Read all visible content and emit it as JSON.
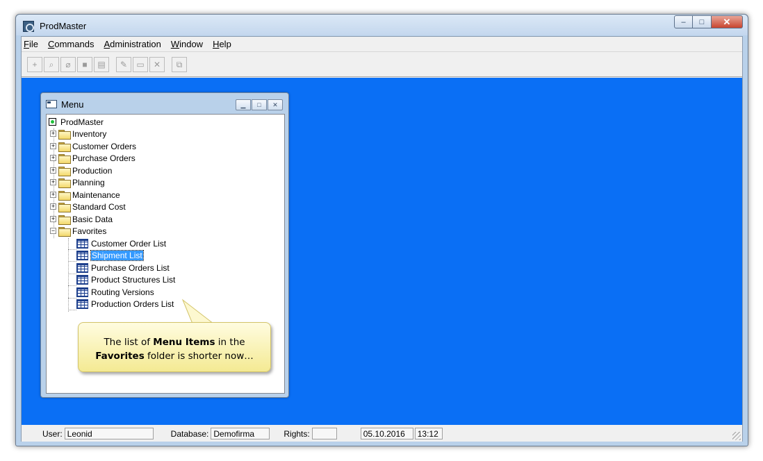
{
  "window": {
    "title": "ProdMaster",
    "buttons": {
      "minimize": "–",
      "maximize": "□",
      "close": "✕"
    }
  },
  "menubar": [
    "File",
    "Commands",
    "Administration",
    "Window",
    "Help"
  ],
  "toolbar": {
    "icons": [
      "add-icon",
      "binoculars-icon",
      "eraser-icon",
      "stop-icon",
      "document-icon",
      "new-folder-icon",
      "folder-icon",
      "delete-icon",
      "copy-icon"
    ]
  },
  "menu_window": {
    "title": "Menu",
    "root": "ProdMaster",
    "folders": [
      "Inventory",
      "Customer Orders",
      "Purchase Orders",
      "Production",
      "Planning",
      "Maintenance",
      "Standard Cost",
      "Basic Data",
      "Favorites"
    ],
    "favorites": [
      "Customer Order List",
      "Shipment List",
      "Purchase Orders List",
      "Product Structures List",
      "Routing Versions",
      "Production Orders List"
    ],
    "selected": "Shipment List"
  },
  "callout": {
    "text_1": "The list of ",
    "bold_1": "Menu Items",
    "text_2": " in the",
    "bold_2": "Favorites",
    "text_3": " folder is shorter now…"
  },
  "statusbar": {
    "user_label": "User:",
    "user": "Leonid",
    "database_label": "Database:",
    "database": "Demofirma",
    "rights_label": "Rights:",
    "rights": "",
    "date": "05.10.2016",
    "time": "13:12"
  },
  "colors": {
    "desktop": "#0a6ff5",
    "selection": "#3399ff",
    "callout": "#f8f0a8"
  }
}
